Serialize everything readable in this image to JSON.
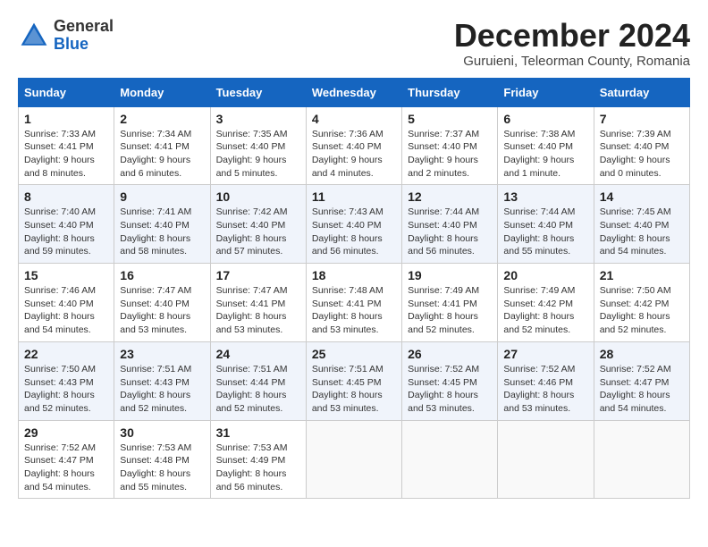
{
  "header": {
    "logo_line1": "General",
    "logo_line2": "Blue",
    "month_title": "December 2024",
    "subtitle": "Guruieni, Teleorman County, Romania"
  },
  "weekdays": [
    "Sunday",
    "Monday",
    "Tuesday",
    "Wednesday",
    "Thursday",
    "Friday",
    "Saturday"
  ],
  "weeks": [
    [
      {
        "day": "1",
        "text": "Sunrise: 7:33 AM\nSunset: 4:41 PM\nDaylight: 9 hours and 8 minutes."
      },
      {
        "day": "2",
        "text": "Sunrise: 7:34 AM\nSunset: 4:41 PM\nDaylight: 9 hours and 6 minutes."
      },
      {
        "day": "3",
        "text": "Sunrise: 7:35 AM\nSunset: 4:40 PM\nDaylight: 9 hours and 5 minutes."
      },
      {
        "day": "4",
        "text": "Sunrise: 7:36 AM\nSunset: 4:40 PM\nDaylight: 9 hours and 4 minutes."
      },
      {
        "day": "5",
        "text": "Sunrise: 7:37 AM\nSunset: 4:40 PM\nDaylight: 9 hours and 2 minutes."
      },
      {
        "day": "6",
        "text": "Sunrise: 7:38 AM\nSunset: 4:40 PM\nDaylight: 9 hours and 1 minute."
      },
      {
        "day": "7",
        "text": "Sunrise: 7:39 AM\nSunset: 4:40 PM\nDaylight: 9 hours and 0 minutes."
      }
    ],
    [
      {
        "day": "8",
        "text": "Sunrise: 7:40 AM\nSunset: 4:40 PM\nDaylight: 8 hours and 59 minutes."
      },
      {
        "day": "9",
        "text": "Sunrise: 7:41 AM\nSunset: 4:40 PM\nDaylight: 8 hours and 58 minutes."
      },
      {
        "day": "10",
        "text": "Sunrise: 7:42 AM\nSunset: 4:40 PM\nDaylight: 8 hours and 57 minutes."
      },
      {
        "day": "11",
        "text": "Sunrise: 7:43 AM\nSunset: 4:40 PM\nDaylight: 8 hours and 56 minutes."
      },
      {
        "day": "12",
        "text": "Sunrise: 7:44 AM\nSunset: 4:40 PM\nDaylight: 8 hours and 56 minutes."
      },
      {
        "day": "13",
        "text": "Sunrise: 7:44 AM\nSunset: 4:40 PM\nDaylight: 8 hours and 55 minutes."
      },
      {
        "day": "14",
        "text": "Sunrise: 7:45 AM\nSunset: 4:40 PM\nDaylight: 8 hours and 54 minutes."
      }
    ],
    [
      {
        "day": "15",
        "text": "Sunrise: 7:46 AM\nSunset: 4:40 PM\nDaylight: 8 hours and 54 minutes."
      },
      {
        "day": "16",
        "text": "Sunrise: 7:47 AM\nSunset: 4:40 PM\nDaylight: 8 hours and 53 minutes."
      },
      {
        "day": "17",
        "text": "Sunrise: 7:47 AM\nSunset: 4:41 PM\nDaylight: 8 hours and 53 minutes."
      },
      {
        "day": "18",
        "text": "Sunrise: 7:48 AM\nSunset: 4:41 PM\nDaylight: 8 hours and 53 minutes."
      },
      {
        "day": "19",
        "text": "Sunrise: 7:49 AM\nSunset: 4:41 PM\nDaylight: 8 hours and 52 minutes."
      },
      {
        "day": "20",
        "text": "Sunrise: 7:49 AM\nSunset: 4:42 PM\nDaylight: 8 hours and 52 minutes."
      },
      {
        "day": "21",
        "text": "Sunrise: 7:50 AM\nSunset: 4:42 PM\nDaylight: 8 hours and 52 minutes."
      }
    ],
    [
      {
        "day": "22",
        "text": "Sunrise: 7:50 AM\nSunset: 4:43 PM\nDaylight: 8 hours and 52 minutes."
      },
      {
        "day": "23",
        "text": "Sunrise: 7:51 AM\nSunset: 4:43 PM\nDaylight: 8 hours and 52 minutes."
      },
      {
        "day": "24",
        "text": "Sunrise: 7:51 AM\nSunset: 4:44 PM\nDaylight: 8 hours and 52 minutes."
      },
      {
        "day": "25",
        "text": "Sunrise: 7:51 AM\nSunset: 4:45 PM\nDaylight: 8 hours and 53 minutes."
      },
      {
        "day": "26",
        "text": "Sunrise: 7:52 AM\nSunset: 4:45 PM\nDaylight: 8 hours and 53 minutes."
      },
      {
        "day": "27",
        "text": "Sunrise: 7:52 AM\nSunset: 4:46 PM\nDaylight: 8 hours and 53 minutes."
      },
      {
        "day": "28",
        "text": "Sunrise: 7:52 AM\nSunset: 4:47 PM\nDaylight: 8 hours and 54 minutes."
      }
    ],
    [
      {
        "day": "29",
        "text": "Sunrise: 7:52 AM\nSunset: 4:47 PM\nDaylight: 8 hours and 54 minutes."
      },
      {
        "day": "30",
        "text": "Sunrise: 7:53 AM\nSunset: 4:48 PM\nDaylight: 8 hours and 55 minutes."
      },
      {
        "day": "31",
        "text": "Sunrise: 7:53 AM\nSunset: 4:49 PM\nDaylight: 8 hours and 56 minutes."
      },
      {
        "day": "",
        "text": ""
      },
      {
        "day": "",
        "text": ""
      },
      {
        "day": "",
        "text": ""
      },
      {
        "day": "",
        "text": ""
      }
    ]
  ]
}
